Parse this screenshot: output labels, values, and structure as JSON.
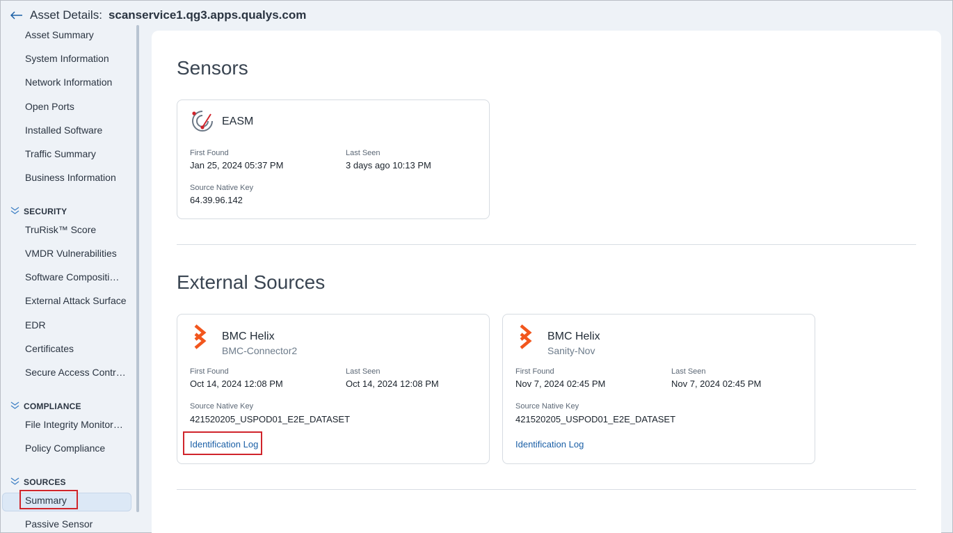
{
  "header": {
    "label": "Asset Details:",
    "host": "scanservice1.qg3.apps.qualys.com"
  },
  "sidebar": {
    "items_top": [
      "Asset Summary",
      "System Information",
      "Network Information",
      "Open Ports",
      "Installed Software",
      "Traffic Summary",
      "Business Information"
    ],
    "security": {
      "title": "SECURITY",
      "items": [
        "TruRisk™ Score",
        "VMDR Vulnerabilities",
        "Software Compositi…",
        "External Attack Surface",
        "EDR",
        "Certificates",
        "Secure Access Contr…"
      ]
    },
    "compliance": {
      "title": "COMPLIANCE",
      "items": [
        "File Integrity Monitor…",
        "Policy Compliance"
      ]
    },
    "sources": {
      "title": "SOURCES",
      "items": [
        "Summary",
        "Passive Sensor"
      ]
    }
  },
  "sensors": {
    "title": "Sensors",
    "card": {
      "name": "EASM",
      "first_found_label": "First Found",
      "first_found": "Jan 25, 2024 05:37 PM",
      "last_seen_label": "Last Seen",
      "last_seen": "3 days ago 10:13 PM",
      "native_key_label": "Source Native Key",
      "native_key": "64.39.96.142"
    }
  },
  "external": {
    "title": "External Sources",
    "cards": [
      {
        "name": "BMC Helix",
        "subtitle": "BMC-Connector2",
        "first_found_label": "First Found",
        "first_found": "Oct 14, 2024 12:08 PM",
        "last_seen_label": "Last Seen",
        "last_seen": "Oct 14, 2024 12:08 PM",
        "native_key_label": "Source Native Key",
        "native_key": "421520205_USPOD01_E2E_DATASET",
        "link": "Identification Log"
      },
      {
        "name": "BMC Helix",
        "subtitle": "Sanity-Nov",
        "first_found_label": "First Found",
        "first_found": "Nov 7, 2024 02:45 PM",
        "last_seen_label": "Last Seen",
        "last_seen": "Nov 7, 2024 02:45 PM",
        "native_key_label": "Source Native Key",
        "native_key": "421520205_USPOD01_E2E_DATASET",
        "link": "Identification Log"
      }
    ]
  },
  "colors": {
    "accent": "#1a5fa6",
    "highlight": "#d0242b",
    "bmc_orange": "#f2561d",
    "active_bg": "#dce8f6"
  }
}
